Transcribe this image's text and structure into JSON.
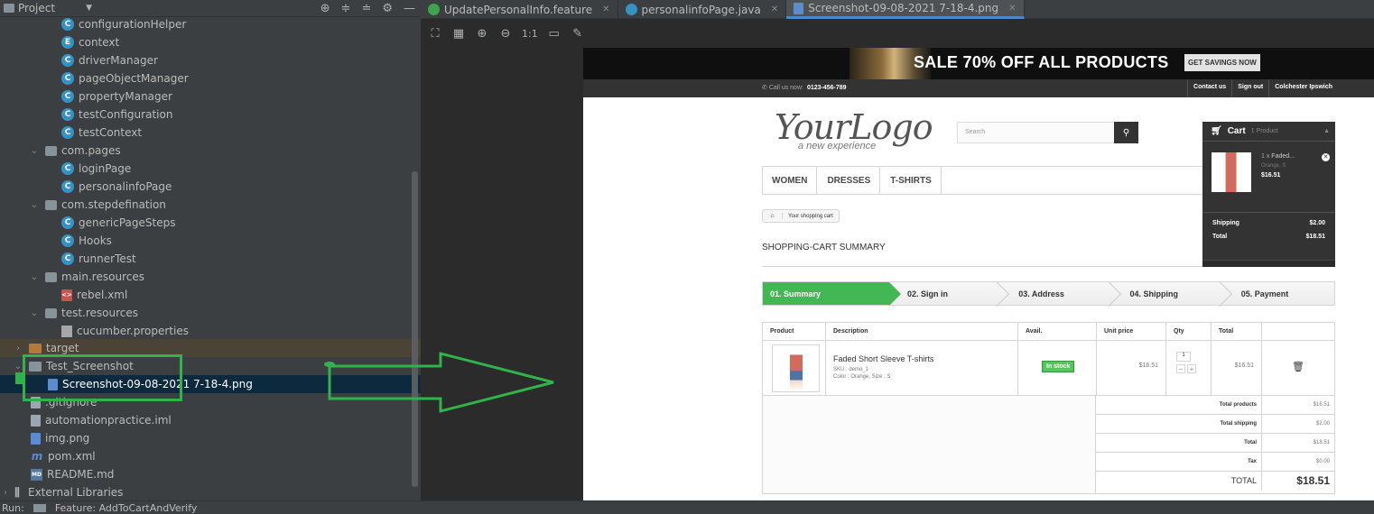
{
  "project_panel": {
    "title": "Project",
    "tree": [
      {
        "label": "configurationHelper",
        "icon": "class-icon",
        "glyph": "C"
      },
      {
        "label": "context",
        "icon": "enum-icon",
        "glyph": "E"
      },
      {
        "label": "driverManager",
        "icon": "class-icon",
        "glyph": "C"
      },
      {
        "label": "pageObjectManager",
        "icon": "class-icon",
        "glyph": "C"
      },
      {
        "label": "propertyManager",
        "icon": "class-icon",
        "glyph": "C"
      },
      {
        "label": "testConfiguration",
        "icon": "class-icon",
        "glyph": "C"
      },
      {
        "label": "testContext",
        "icon": "class-icon",
        "glyph": "C"
      },
      {
        "label": "com.pages",
        "icon": "package-icon"
      },
      {
        "label": "loginPage",
        "icon": "class-icon",
        "glyph": "C"
      },
      {
        "label": "personalinfoPage",
        "icon": "class-icon",
        "glyph": "C"
      },
      {
        "label": "com.stepdefination",
        "icon": "package-icon"
      },
      {
        "label": "genericPageSteps",
        "icon": "class-icon",
        "glyph": "C"
      },
      {
        "label": "Hooks",
        "icon": "class-icon",
        "glyph": "C"
      },
      {
        "label": "runnerTest",
        "icon": "class-icon",
        "glyph": "C"
      },
      {
        "label": "main.resources",
        "icon": "package-icon"
      },
      {
        "label": "rebel.xml",
        "icon": "xml-icon",
        "glyph": "<>"
      },
      {
        "label": "test.resources",
        "icon": "package-icon"
      },
      {
        "label": "cucumber.properties",
        "icon": "properties-icon"
      },
      {
        "label": "target",
        "icon": "folder-icon"
      },
      {
        "label": "Test_Screenshot",
        "icon": "folder-icon"
      },
      {
        "label": "Screenshot-09-08-2021 7-18-4.png",
        "icon": "image-file-icon"
      },
      {
        "label": ".gitignore",
        "icon": "file-icon"
      },
      {
        "label": "automationpractice.iml",
        "icon": "module-file-icon"
      },
      {
        "label": "img.png",
        "icon": "image-file-icon"
      },
      {
        "label": "pom.xml",
        "icon": "maven-icon",
        "glyph": "m"
      },
      {
        "label": "README.md",
        "icon": "markdown-icon",
        "glyph": "MD"
      },
      {
        "label": "External Libraries",
        "icon": "library-icon"
      }
    ]
  },
  "status_bar": {
    "left": "Run:",
    "feature": "Feature: AddToCartAndVerify"
  },
  "editor": {
    "tabs": [
      {
        "label": "UpdatePersonalInfo.feature",
        "color": "#3fa34d"
      },
      {
        "label": "personalinfoPage.java",
        "color": "#3592c4"
      },
      {
        "label": "Screenshot-09-08-2021 7-18-4.png",
        "color": "#5a8ccf"
      }
    ],
    "zoom_label": "1:1"
  },
  "screenshot": {
    "banner": {
      "sale": "SALE 70% OFF ALL PRODUCTS",
      "button": "GET SAVINGS NOW"
    },
    "nav": {
      "call_label": "Call us now:",
      "phone": "0123-456-789",
      "links": [
        "Contact us",
        "Sign out",
        "Colchester Ipswich"
      ]
    },
    "logo": {
      "text": "YourLogo",
      "tagline": "a new experience"
    },
    "search_placeholder": "Search",
    "cart": {
      "title": "Cart",
      "count": "1 Product",
      "item_qty": "1 x",
      "item_name": "Faded...",
      "item_attr": "Orange, S",
      "item_price": "$16.51",
      "shipping_label": "Shipping",
      "shipping_value": "$2.00",
      "total_label": "Total",
      "total_value": "$18.51"
    },
    "menu": [
      "WOMEN",
      "DRESSES",
      "T-SHIRTS"
    ],
    "breadcrumb": "Your shopping cart",
    "summary_title": "SHOPPING-CART SUMMARY",
    "steps": [
      "01. Summary",
      "02. Sign in",
      "03. Address",
      "04. Shipping",
      "05. Payment"
    ],
    "table": {
      "headers": [
        "Product",
        "Description",
        "Avail.",
        "Unit price",
        "Qty",
        "Total",
        ""
      ],
      "row": {
        "name": "Faded Short Sleeve T-shirts",
        "sku": "SKU : demo_1",
        "attr": "Color : Orange, Size : S",
        "avail": "In stock",
        "unit_price": "$16.51",
        "qty": "1",
        "total": "$16.51"
      },
      "totals": [
        {
          "label": "Total products",
          "value": "$16.51"
        },
        {
          "label": "Total shipping",
          "value": "$2.00"
        },
        {
          "label": "Total",
          "value": "$18.51"
        },
        {
          "label": "Tax",
          "value": "$0.00"
        },
        {
          "label": "TOTAL",
          "value": "$18.51"
        }
      ]
    }
  },
  "annotation": {
    "color": "#2fb34a"
  }
}
